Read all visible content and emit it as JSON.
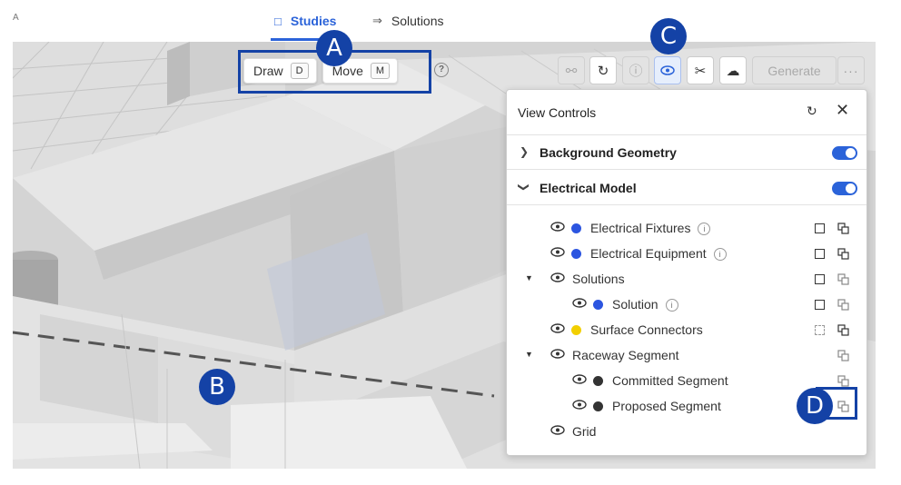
{
  "header": {
    "corner_mark": "A",
    "tabs": [
      {
        "label": "Studies",
        "icon": "book-icon",
        "active": true
      },
      {
        "label": "Solutions",
        "icon": "branch-icon",
        "active": false
      }
    ]
  },
  "mode_toolbar": {
    "draw_label": "Draw",
    "draw_key": "D",
    "move_label": "Move",
    "move_key": "M",
    "help": "?"
  },
  "right_toolbar": {
    "generate_label": "Generate",
    "more_label": "···",
    "icons": [
      "link-icon",
      "refresh-icon",
      "info-icon",
      "eye-icon",
      "scissors-icon",
      "cloud-upload-icon"
    ]
  },
  "view_controls": {
    "title": "View Controls",
    "sections": [
      {
        "label": "Background Geometry",
        "expanded": false,
        "enabled": true
      },
      {
        "label": "Electrical Model",
        "expanded": true,
        "enabled": true
      }
    ],
    "layers": [
      {
        "label": "Electrical Fixtures",
        "color": "#2c55e0",
        "info": true
      },
      {
        "label": "Electrical Equipment",
        "color": "#2c55e0",
        "info": true
      },
      {
        "label": "Solutions",
        "color": null,
        "info": false
      },
      {
        "label": "Solution",
        "color": "#2c55e0",
        "info": true
      },
      {
        "label": "Surface Connectors",
        "color": "#f2cf00",
        "info": false
      },
      {
        "label": "Raceway Segment",
        "color": null,
        "info": false
      },
      {
        "label": "Committed Segment",
        "color": "#333333",
        "info": false
      },
      {
        "label": "Proposed Segment",
        "color": "#333333",
        "info": false
      },
      {
        "label": "Grid",
        "color": null,
        "info": false
      }
    ]
  },
  "callouts": {
    "a": "A",
    "b": "B",
    "c": "C",
    "d": "D"
  },
  "colors": {
    "accent": "#2b63d9",
    "callout": "#1442a6"
  }
}
